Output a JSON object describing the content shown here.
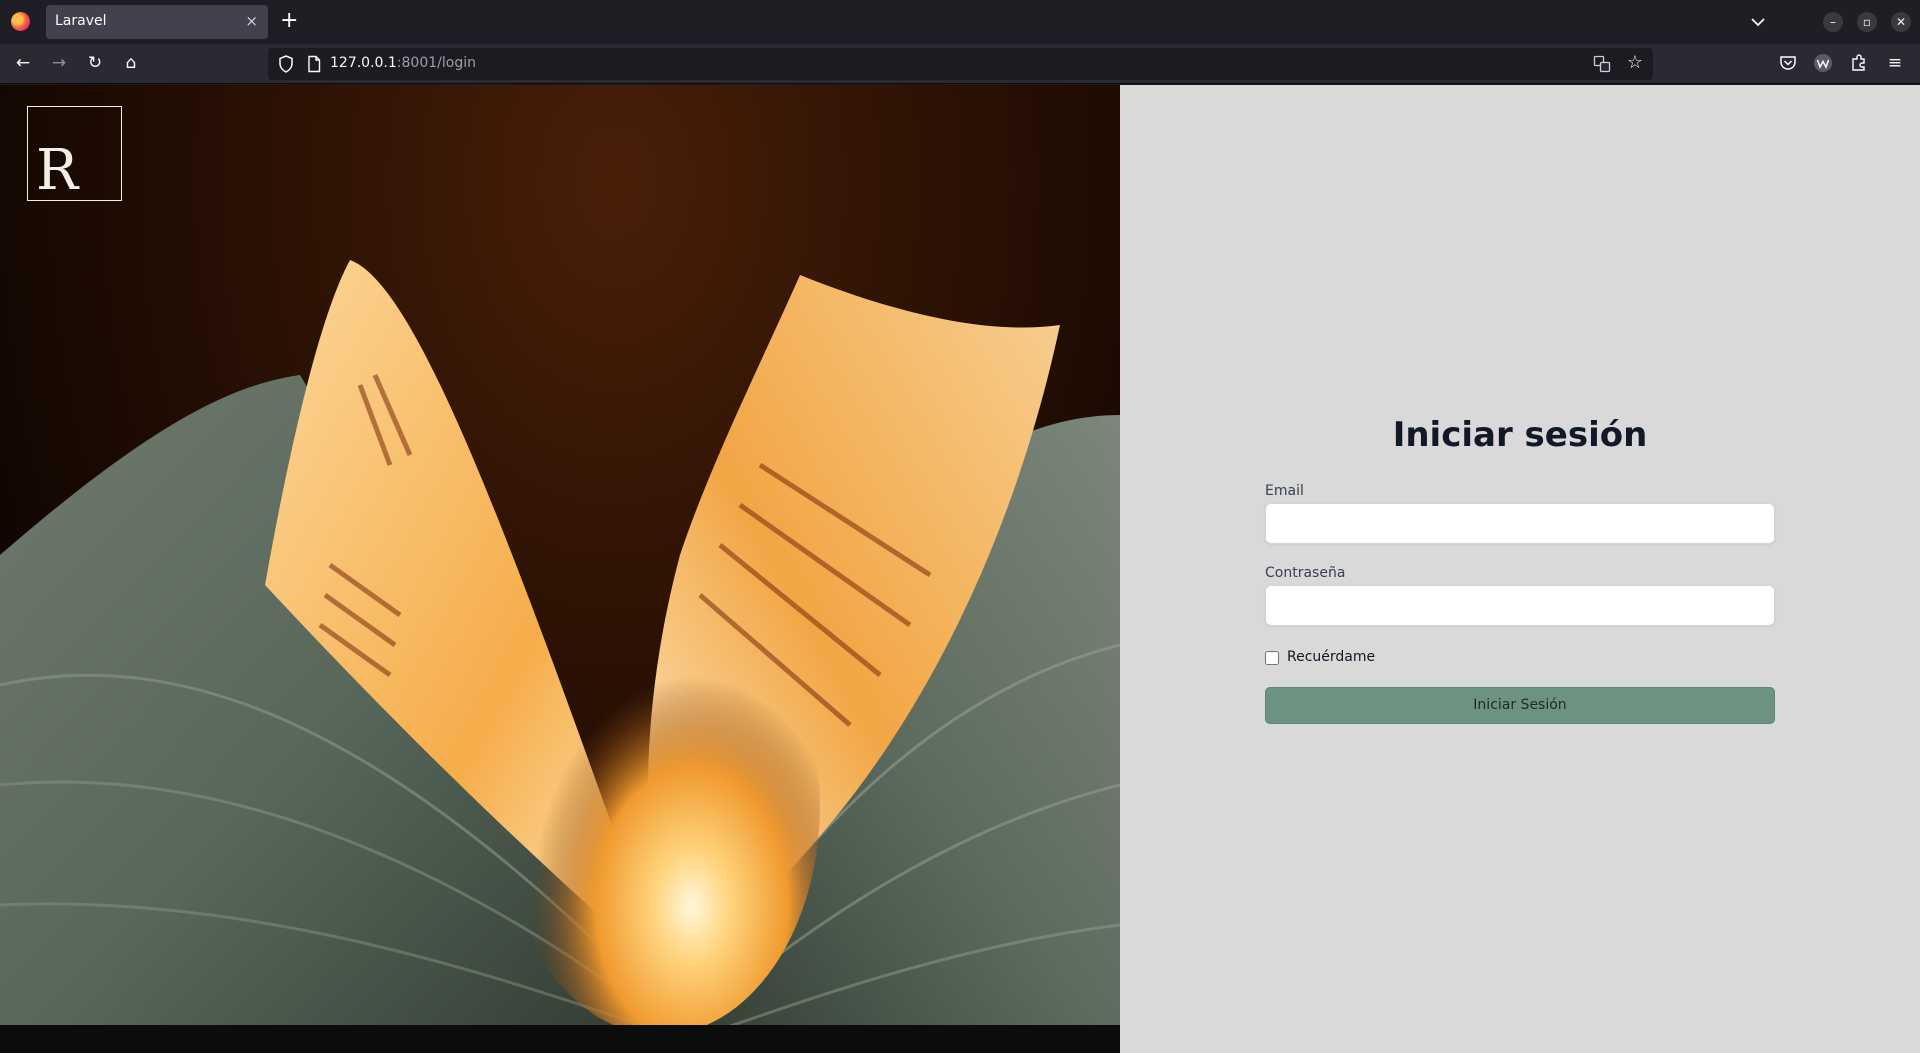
{
  "browser": {
    "tab_title": "Laravel",
    "tab_close": "×",
    "new_tab": "+",
    "url_host": "127.0.0.1",
    "url_path": ":8001/login",
    "back": "←",
    "forward": "→",
    "reload": "↻",
    "home": "⌂",
    "bookmark": "☆",
    "menu": "≡",
    "minimize": "–",
    "maximize": "▫",
    "close": "✕"
  },
  "hero": {
    "logo_letter": "R"
  },
  "login": {
    "title": "Iniciar sesión",
    "email_label": "Email",
    "email_value": "",
    "password_label": "Contraseña",
    "password_value": "",
    "remember_label": "Recuérdame",
    "remember_checked": false,
    "submit_label": "Iniciar Sesión"
  },
  "colors": {
    "panel_bg": "#d9d9d9",
    "button_bg": "#6b9380",
    "title_text": "#111827"
  }
}
